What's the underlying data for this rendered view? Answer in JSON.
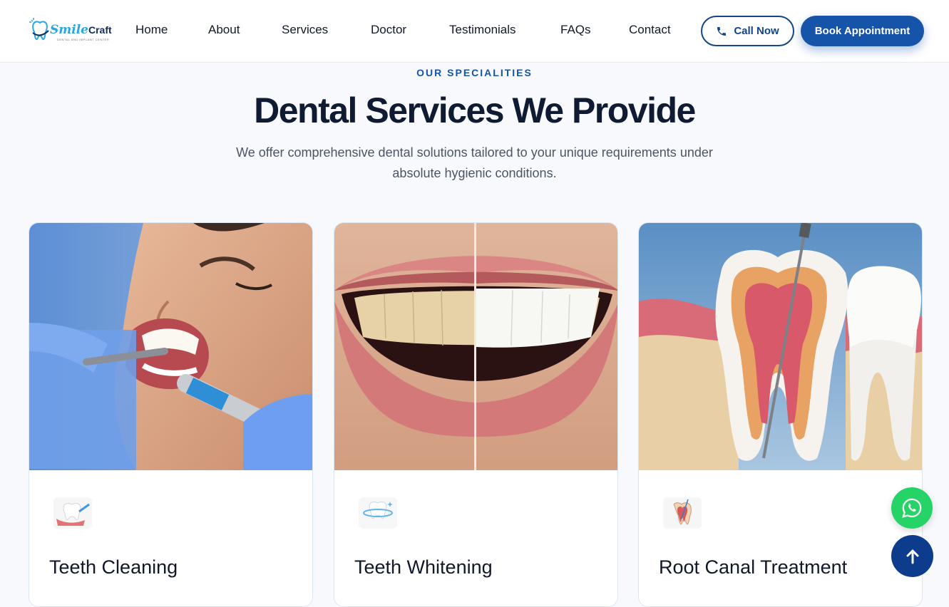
{
  "header": {
    "logo": {
      "brand_a": "Smile",
      "brand_b": "Craft",
      "tagline": "DENTAL AND IMPLANT CENTER"
    },
    "nav": [
      {
        "label": "Home"
      },
      {
        "label": "About"
      },
      {
        "label": "Services"
      },
      {
        "label": "Doctor"
      },
      {
        "label": "Testimonials"
      },
      {
        "label": "FAQs"
      },
      {
        "label": "Contact"
      }
    ],
    "call_label": "Call Now",
    "book_label": "Book Appointment"
  },
  "section": {
    "eyebrow": "OUR SPECIALITIES",
    "title": "Dental Services We Provide",
    "description": "We offer comprehensive dental solutions tailored to your unique requirements under absolute hygienic conditions."
  },
  "cards": [
    {
      "title": "Teeth Cleaning",
      "icon": "tooth-cleaning-icon"
    },
    {
      "title": "Teeth Whitening",
      "icon": "tooth-sparkle-icon"
    },
    {
      "title": "Root Canal Treatment",
      "icon": "root-canal-icon"
    }
  ],
  "floating": {
    "whatsapp_icon": "whatsapp-icon",
    "scroll_icon": "arrow-up-icon"
  },
  "colors": {
    "primary": "#1654aa",
    "navy": "#0d3c8c",
    "whatsapp": "#25d366",
    "title": "#0f1a33"
  }
}
